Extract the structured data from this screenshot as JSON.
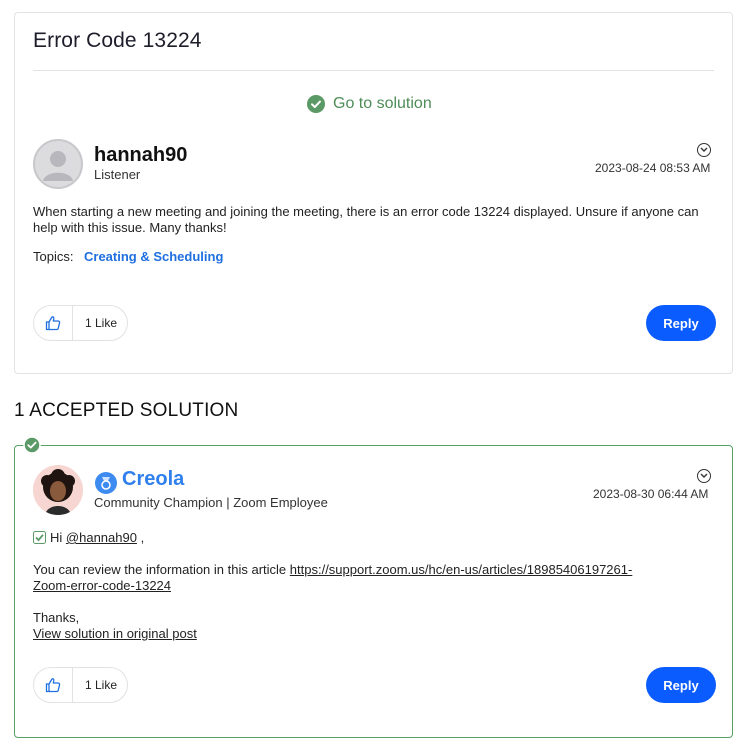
{
  "question": {
    "title": "Error Code 13224",
    "goto_solution_label": "Go to solution",
    "author": {
      "name": "hannah90",
      "role": "Listener"
    },
    "timestamp": "2023-08-24 08:53 AM",
    "body": "When starting a new meeting and joining the meeting, there is an error code 13224 displayed. Unsure if anyone can help with this issue. Many thanks!",
    "topics_label": "Topics:",
    "topic": "Creating & Scheduling",
    "likes": "1 Like",
    "reply_label": "Reply"
  },
  "solutions_header": "1 ACCEPTED SOLUTION",
  "solution": {
    "author": {
      "name": "Creola",
      "role": "Community Champion | Zoom Employee"
    },
    "timestamp": "2023-08-30 06:44 AM",
    "greeting_prefix": "Hi",
    "mention": "@hannah90",
    "greeting_suffix": ",",
    "review_text": "You can review the information in this article",
    "link_part1": "https://support.zoom.us/hc/en-us/articles/18985406197261-",
    "link_part2": "Zoom-error-code-13224",
    "thanks": "Thanks,",
    "view_link": "View solution in original post",
    "likes": "1 Like",
    "reply_label": "Reply"
  },
  "colors": {
    "accent_blue": "#0b5cff",
    "link_blue": "#1f6fe0",
    "solution_green": "#57a065"
  },
  "icons": [
    "check-circle-icon",
    "default-avatar-icon",
    "chevron-down-icon",
    "thumbs-up-icon",
    "champion-badge-icon",
    "checkbox-check-icon"
  ]
}
